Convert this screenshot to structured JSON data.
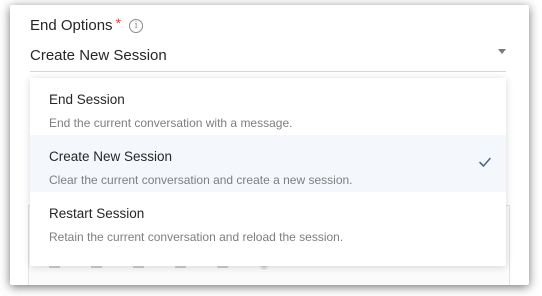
{
  "field": {
    "label": "End Options",
    "required_mark": "*",
    "info_icon": "info-icon",
    "value": "Create New Session",
    "caret_icon": "caret-down-icon"
  },
  "dropdown": {
    "options": [
      {
        "title": "End Session",
        "description": "End the current conversation with a message.",
        "selected": false
      },
      {
        "title": "Create New Session",
        "description": "Clear the current conversation and create a new session.",
        "selected": true
      },
      {
        "title": "Restart Session",
        "description": "Retain the current conversation and reload the session.",
        "selected": false
      }
    ],
    "check_icon": "check-icon"
  },
  "colors": {
    "required": "#e0443a",
    "selected_bg": "#f4f8fc",
    "check": "#4a6a8a"
  }
}
